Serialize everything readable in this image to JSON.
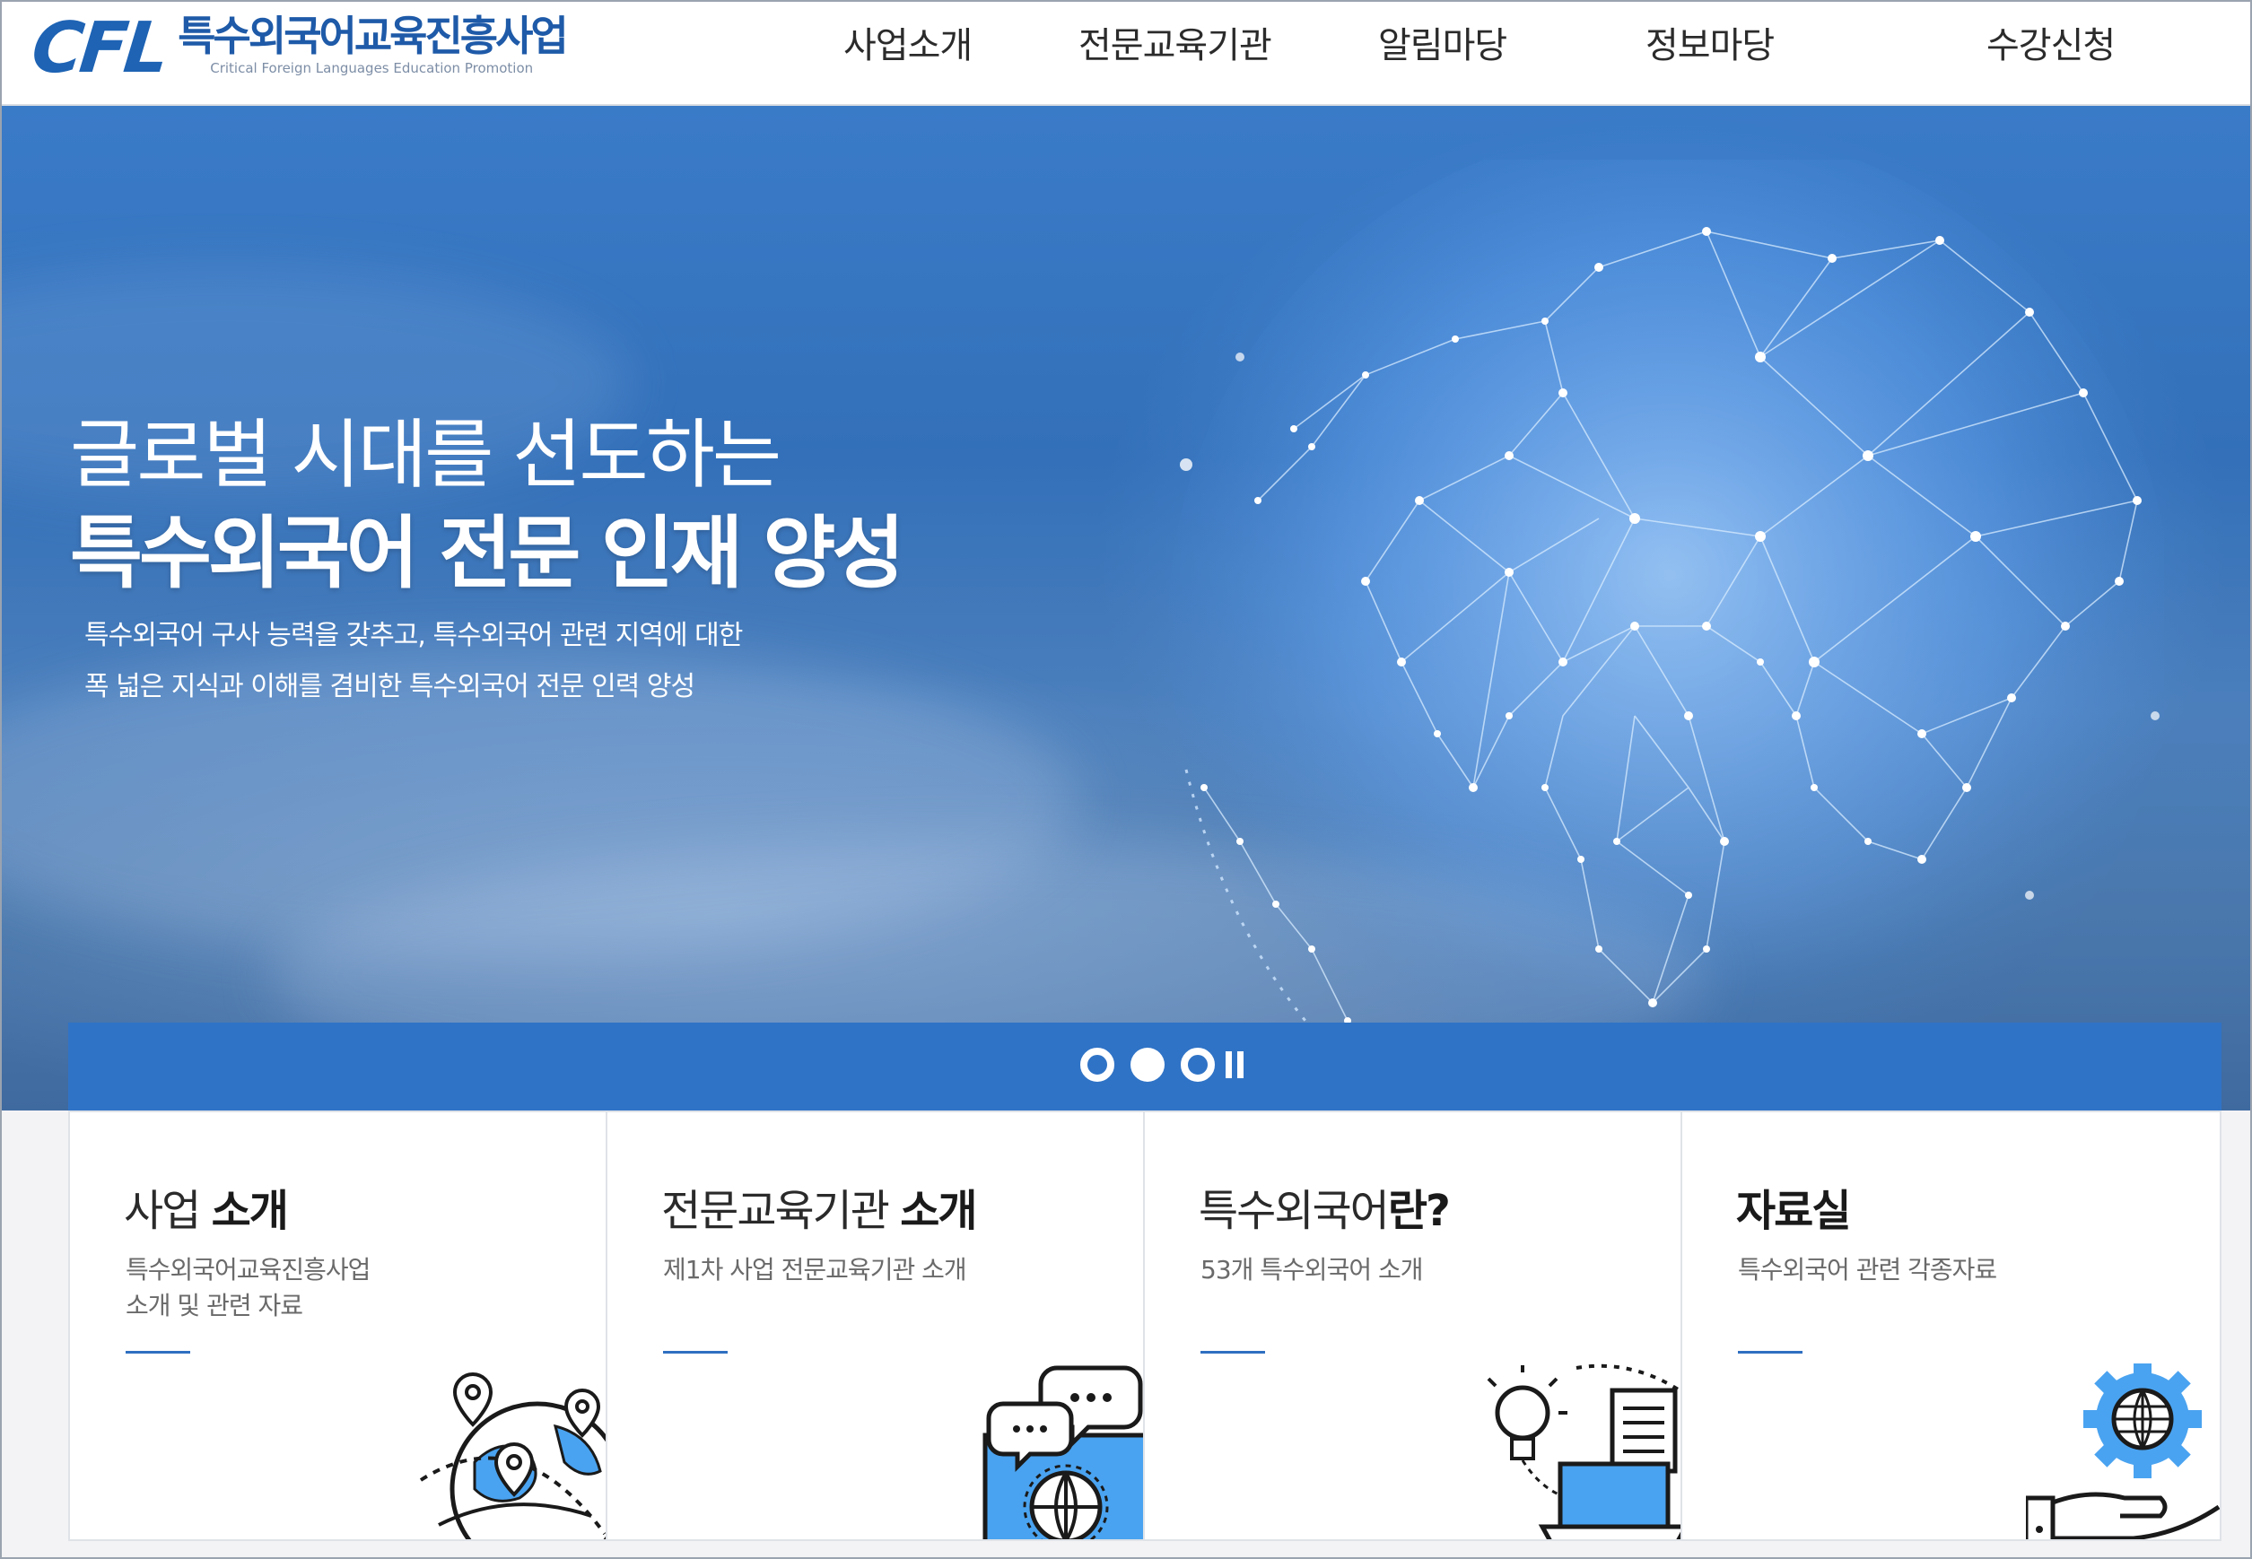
{
  "header": {
    "logo_mark": "CFL",
    "logo_title": "특수외국어교육진흥사업",
    "logo_subtitle": "Critical Foreign Languages Education Promotion",
    "nav": [
      {
        "label": "사업소개"
      },
      {
        "label": "전문교육기관"
      },
      {
        "label": "알림마당"
      },
      {
        "label": "정보마당"
      },
      {
        "label": "수강신청"
      }
    ]
  },
  "hero": {
    "title_line1": "글로벌 시대를 선도하는",
    "title_line2": "특수외국어 전문 인재 양성",
    "desc_line1": "특수외국어 구사 능력을 갖추고, 특수외국어 관련 지역에 대한",
    "desc_line2": "폭 넓은 지식과 이해를 겸비한 특수외국어 전문 인력 양성"
  },
  "slider": {
    "slide_count": 3,
    "active_index": 1,
    "accent": "#2f73c6"
  },
  "cards": [
    {
      "title_normal": "사업 ",
      "title_bold": "소개",
      "desc_line1": "특수외국어교육진흥사업",
      "desc_line2": "소개 및 관련 자료",
      "icon": "globe-pins-icon"
    },
    {
      "title_normal": "전문교육기관 ",
      "title_bold": "소개",
      "desc_line1": "제1차 사업 전문교육기관 소개",
      "desc_line2": "",
      "icon": "chat-globe-icon"
    },
    {
      "title_normal": "특수외국어",
      "title_bold": "란?",
      "desc_line1": "53개 특수외국어 소개",
      "desc_line2": "",
      "icon": "idea-laptop-icon"
    },
    {
      "title_normal": "",
      "title_bold": "자료실",
      "desc_line1": "특수외국어 관련 각종자료",
      "desc_line2": "",
      "icon": "gear-globe-hand-icon"
    }
  ],
  "colors": {
    "brand": "#1e63b4",
    "accent_blue": "#2f73c6",
    "icon_light_blue": "#4aa3f0"
  }
}
